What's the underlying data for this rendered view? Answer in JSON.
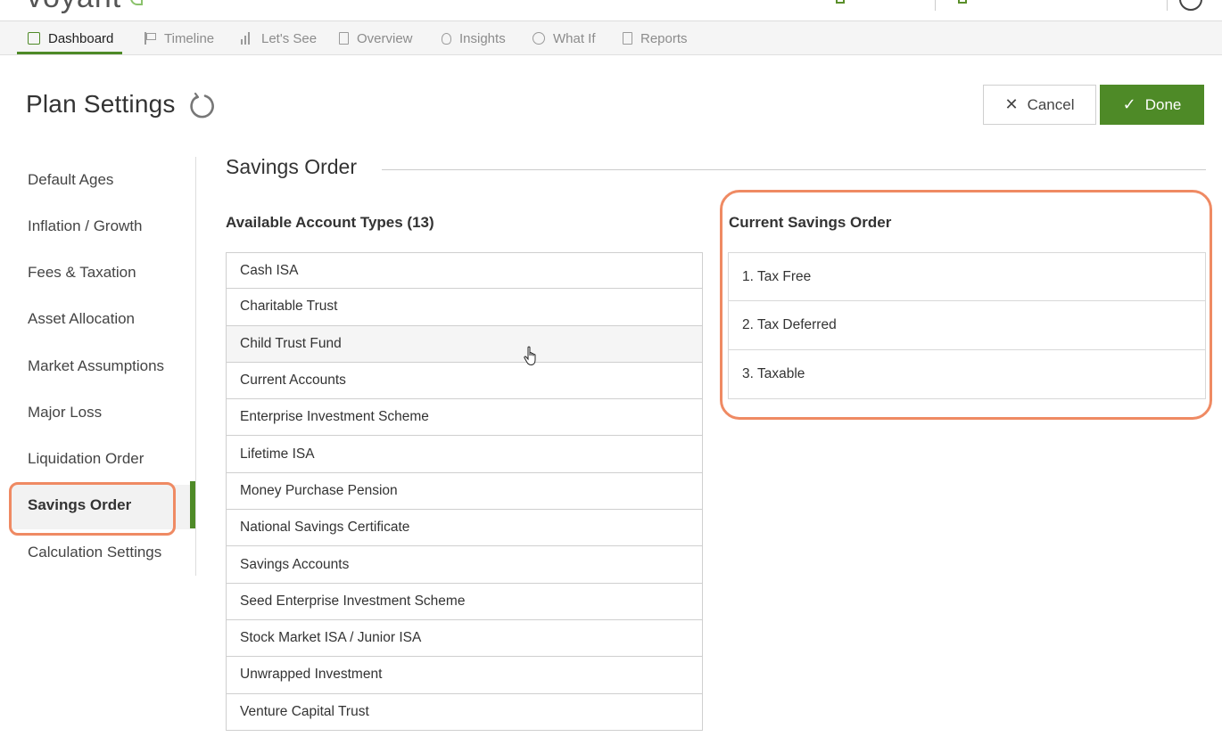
{
  "header": {
    "logo_text": "voyant"
  },
  "nav": {
    "tabs": [
      {
        "label": "Dashboard",
        "icon": "dashboard-icon",
        "active": true
      },
      {
        "label": "Timeline",
        "icon": "flag-icon"
      },
      {
        "label": "Let's See",
        "icon": "bar-chart-icon"
      },
      {
        "label": "Overview",
        "icon": "document-icon"
      },
      {
        "label": "Insights",
        "icon": "lightbulb-icon"
      },
      {
        "label": "What If",
        "icon": "what-if-icon"
      },
      {
        "label": "Reports",
        "icon": "report-icon"
      }
    ]
  },
  "page": {
    "title": "Plan Settings",
    "cancel_label": "Cancel",
    "done_label": "Done",
    "cancel_glyph": "✕",
    "done_glyph": "✓"
  },
  "sidebar": {
    "items": [
      {
        "label": "Default Ages"
      },
      {
        "label": "Inflation / Growth"
      },
      {
        "label": "Fees & Taxation"
      },
      {
        "label": "Asset Allocation"
      },
      {
        "label": "Market Assumptions"
      },
      {
        "label": "Major Loss"
      },
      {
        "label": "Liquidation Order"
      },
      {
        "label": "Savings Order",
        "active": true
      },
      {
        "label": "Calculation Settings"
      }
    ]
  },
  "main": {
    "section_title": "Savings Order",
    "available_heading": "Available Account Types (13)",
    "available_accounts": [
      "Cash ISA",
      "Charitable Trust",
      "Child Trust Fund",
      "Current Accounts",
      "Enterprise Investment Scheme",
      "Lifetime ISA",
      "Money Purchase Pension",
      "National Savings Certificate",
      "Savings Accounts",
      "Seed Enterprise Investment Scheme",
      "Stock Market ISA / Junior ISA",
      "Unwrapped Investment",
      "Venture Capital Trust"
    ],
    "current_heading": "Current Savings Order",
    "current_order": [
      "1. Tax Free",
      "2. Tax Deferred",
      "3. Taxable"
    ]
  },
  "colors": {
    "brand_green": "#4e8a27",
    "highlight": "#ef8a63"
  }
}
